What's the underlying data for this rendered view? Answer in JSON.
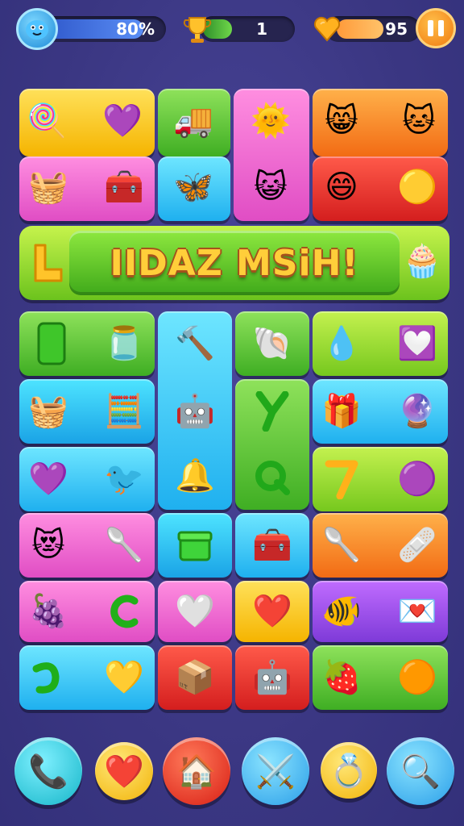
{
  "hud": {
    "player_icon": "blue-blob-icon",
    "progress_text": "80%",
    "progress_fill": 0.8,
    "level_icon": "trophy-icon",
    "level_text": "1",
    "gems_icon": "heart-gem-icon",
    "gems_text": "95",
    "pause_icon": "pause-icon"
  },
  "banner": {
    "title": "IIDAZ MSiH!",
    "left_icon": "yellow-l-block-icon",
    "right_icon": "cupcake-icon"
  },
  "tiles": [
    {
      "id": "t1",
      "items": [
        "🍭",
        "💜"
      ],
      "icons": [
        "blue-lollipop-icon",
        "purple-block-icon"
      ]
    },
    {
      "id": "t2",
      "items": [
        "🧺",
        "🧰"
      ],
      "icons": [
        "crate-icon",
        "blue-box-icon"
      ]
    },
    {
      "id": "t3",
      "items": [
        "🚚"
      ],
      "icons": [
        "truck-icon"
      ]
    },
    {
      "id": "t4",
      "items": [
        "🦋"
      ],
      "icons": [
        "blue-wings-icon"
      ]
    },
    {
      "id": "t5",
      "items": [
        "🌞"
      ],
      "icons": [
        "sun-face-icon"
      ]
    },
    {
      "id": "t6",
      "items": [
        "😺"
      ],
      "icons": [
        "purple-cat-icon"
      ]
    },
    {
      "id": "t7",
      "items": [
        "😸",
        "🐱"
      ],
      "icons": [
        "blue-creature-icon",
        "blue-cat-icon"
      ]
    },
    {
      "id": "t8",
      "items": [
        "😄",
        "🟡"
      ],
      "icons": [
        "boy-face-icon",
        "yellow-ball-icon"
      ]
    }
  ],
  "bottom_bar": [
    {
      "icon": "phone-icon",
      "glyph": "📞"
    },
    {
      "icon": "heart-icon",
      "glyph": "❤️"
    },
    {
      "icon": "home-icon",
      "glyph": "🏠"
    },
    {
      "icon": "sword-icon",
      "glyph": "⚔️"
    },
    {
      "icon": "ring-icon",
      "glyph": "💍"
    },
    {
      "icon": "magic-wand-icon",
      "glyph": "🔍"
    }
  ]
}
